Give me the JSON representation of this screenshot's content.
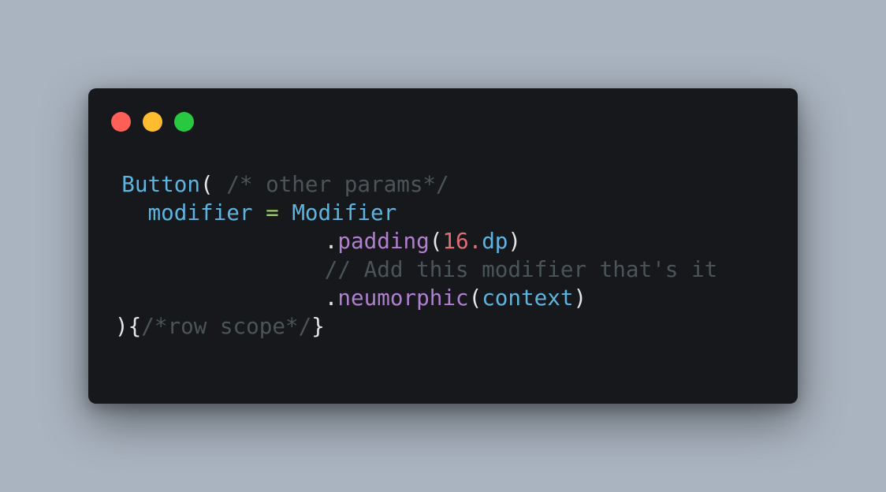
{
  "colors": {
    "background": "#aab4c0",
    "window": "#16181b",
    "traffic_red": "#fe5f57",
    "traffic_yellow": "#febc2e",
    "traffic_green": "#28c840",
    "type": "#5db4e0",
    "property": "#5db4e0",
    "operator": "#9ccc65",
    "function": "#b07fcf",
    "number": "#e06c75",
    "comment": "#4b5559",
    "punctuation": "#e6e6e6"
  },
  "code": {
    "line1": {
      "class_name": "Button",
      "paren_open": "(",
      "comment": "/* other params*/"
    },
    "line2": {
      "param": "modifier",
      "equals": "=",
      "value": "Modifier"
    },
    "line3": {
      "dot": ".",
      "method": "padding",
      "paren_open": "(",
      "number": "16.",
      "unit": "dp",
      "paren_close": ")"
    },
    "line4": {
      "comment": "// Add this modifier that's it"
    },
    "line5": {
      "dot": ".",
      "method": "neumorphic",
      "paren_open": "(",
      "argument": "context",
      "paren_close": ")"
    },
    "line6": {
      "paren_close": ")",
      "brace_open": "{",
      "comment": "/*row scope*/",
      "brace_close": "}"
    }
  }
}
